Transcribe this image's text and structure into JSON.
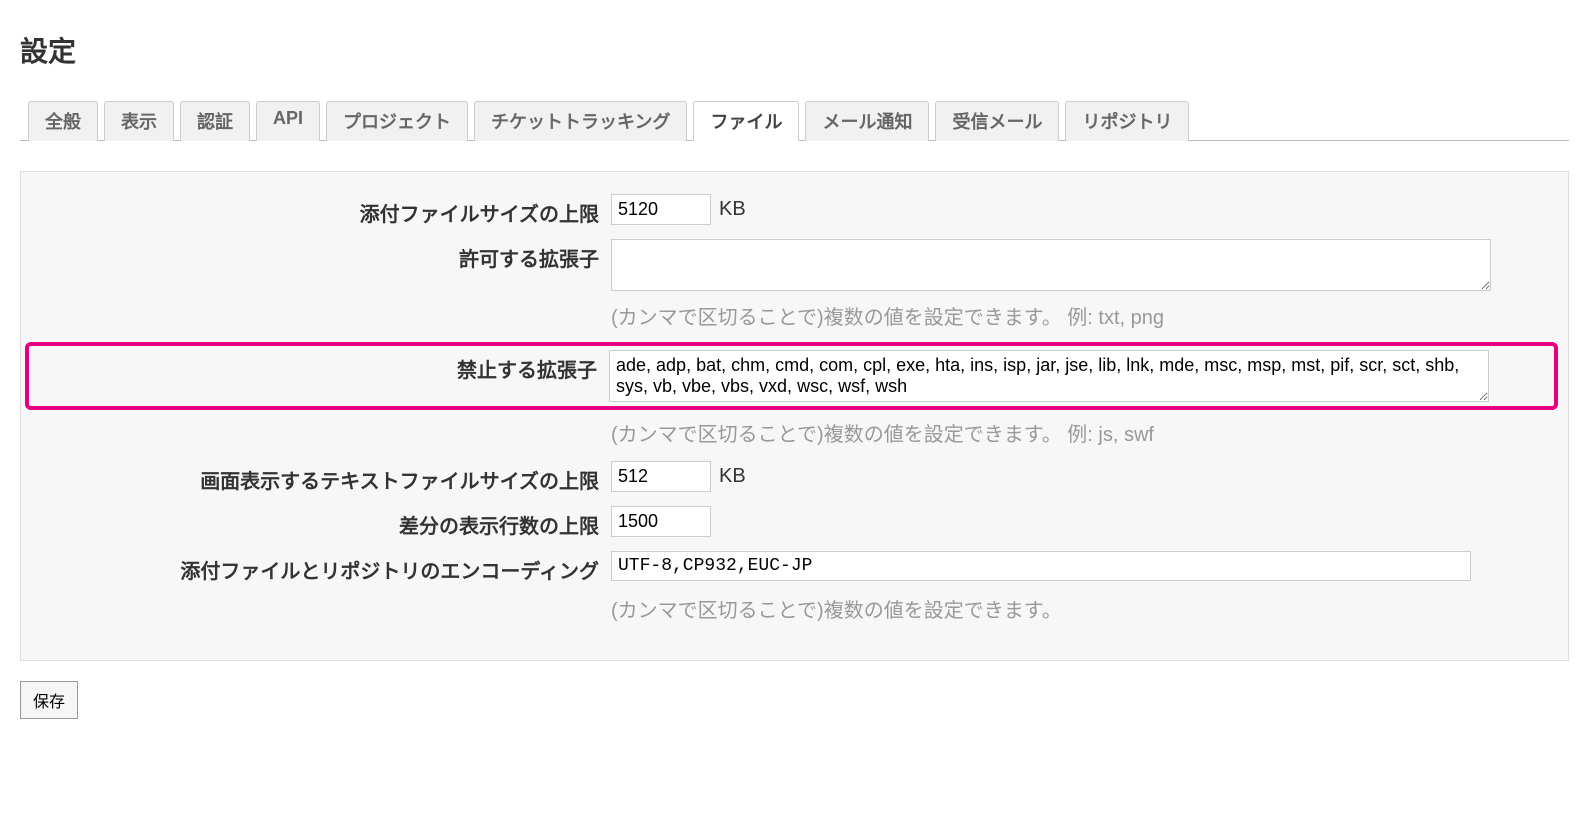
{
  "page_title": "設定",
  "tabs": [
    {
      "id": "general",
      "label": "全般",
      "selected": false
    },
    {
      "id": "display",
      "label": "表示",
      "selected": false
    },
    {
      "id": "auth",
      "label": "認証",
      "selected": false
    },
    {
      "id": "api",
      "label": "API",
      "selected": false
    },
    {
      "id": "projects",
      "label": "プロジェクト",
      "selected": false
    },
    {
      "id": "tracking",
      "label": "チケットトラッキング",
      "selected": false
    },
    {
      "id": "files",
      "label": "ファイル",
      "selected": true
    },
    {
      "id": "mail_notify",
      "label": "メール通知",
      "selected": false
    },
    {
      "id": "mail_recv",
      "label": "受信メール",
      "selected": false
    },
    {
      "id": "repo",
      "label": "リポジトリ",
      "selected": false
    }
  ],
  "fields": {
    "max_attach": {
      "label": "添付ファイルサイズの上限",
      "value": "5120",
      "unit": "KB"
    },
    "allowed_ext": {
      "label": "許可する拡張子",
      "value": "",
      "hint": "(カンマで区切ることで)複数の値を設定できます。 例: txt, png"
    },
    "denied_ext": {
      "label": "禁止する拡張子",
      "value": "ade, adp, bat, chm, cmd, com, cpl, exe, hta, ins, isp, jar, jse, lib, lnk, mde, msc, msp, mst, pif, scr, sct, shb, sys, vb, vbe, vbs, vxd, wsc, wsf, wsh",
      "hint": "(カンマで区切ることで)複数の値を設定できます。 例: js, swf"
    },
    "inline_max": {
      "label": "画面表示するテキストファイルサイズの上限",
      "value": "512",
      "unit": "KB"
    },
    "diff_lines": {
      "label": "差分の表示行数の上限",
      "value": "1500"
    },
    "encodings": {
      "label": "添付ファイルとリポジトリのエンコーディング",
      "value": "UTF-8,CP932,EUC-JP",
      "hint": "(カンマで区切ることで)複数の値を設定できます。"
    }
  },
  "buttons": {
    "save": "保存"
  }
}
